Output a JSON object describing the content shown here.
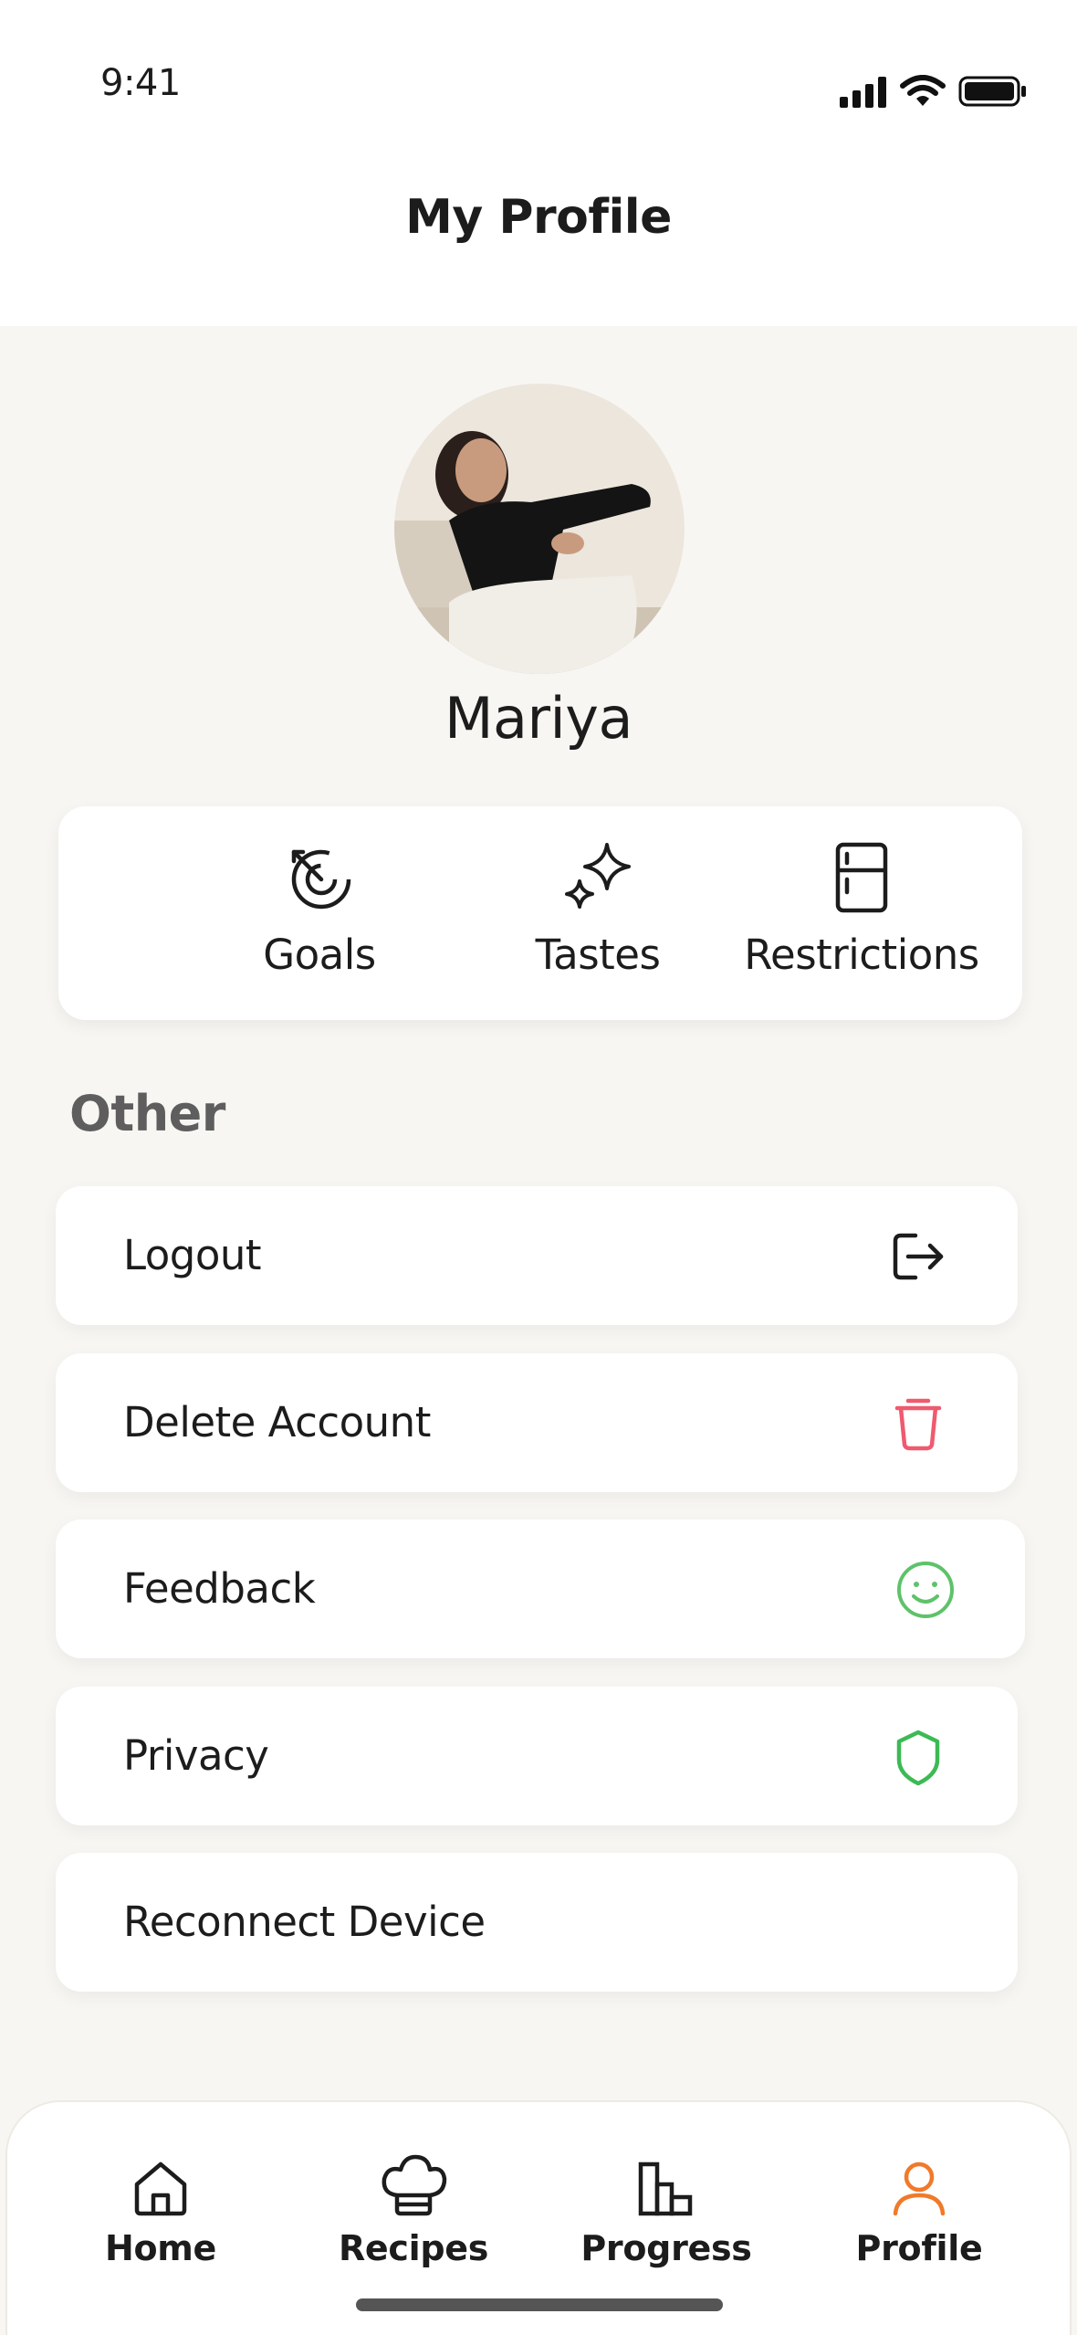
{
  "status_bar": {
    "time": "9:41"
  },
  "header": {
    "title": "My Profile"
  },
  "profile": {
    "name": "Mariya"
  },
  "quick_actions": [
    {
      "label": "Goals",
      "icon": "target-icon"
    },
    {
      "label": "Tastes",
      "icon": "sparkles-icon"
    },
    {
      "label": "Restrictions",
      "icon": "fridge-icon"
    }
  ],
  "other": {
    "title": "Other",
    "items": [
      {
        "label": "Logout",
        "icon": "logout-icon",
        "color": "#1c1c1c"
      },
      {
        "label": "Delete Account",
        "icon": "trash-icon",
        "color": "#ef5a6f"
      },
      {
        "label": "Feedback",
        "icon": "smiley-icon",
        "color": "#5ec26a"
      },
      {
        "label": "Privacy",
        "icon": "shield-icon",
        "color": "#3cba54"
      },
      {
        "label": "Reconnect Device",
        "icon": "",
        "color": ""
      }
    ]
  },
  "bottom_nav": {
    "active": "Profile",
    "accent_color": "#f07a2a",
    "items": [
      {
        "label": "Home",
        "icon": "home-icon"
      },
      {
        "label": "Recipes",
        "icon": "chef-hat-icon"
      },
      {
        "label": "Progress",
        "icon": "bar-chart-icon"
      },
      {
        "label": "Profile",
        "icon": "user-icon"
      }
    ]
  }
}
